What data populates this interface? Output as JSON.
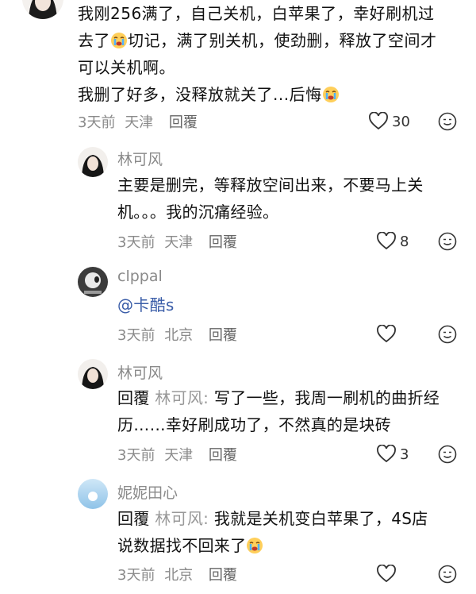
{
  "top_comment": {
    "lines": [
      "我刚256满了，自己关机，白苹果了，幸好刷机过",
      "去了",
      "切记，满了别关机，使劲删，释放了空间才",
      "可以关机啊。",
      "我删了好多，没释放就关了...后悔"
    ],
    "meta_time": "3天前",
    "meta_location": "天津",
    "reply_label": "回覆",
    "likes": "30"
  },
  "replies": [
    {
      "name": "林可风",
      "lines": [
        "主要是删完，等释放空间出来，不要马上关",
        "机。。。我的沉痛经验。"
      ],
      "meta_time": "3天前",
      "meta_location": "天津",
      "reply_label": "回覆",
      "likes": "8"
    },
    {
      "name": "clppal",
      "mention": "@卡酷s",
      "meta_time": "3天前",
      "meta_location": "北京",
      "reply_label": "回覆",
      "likes": ""
    },
    {
      "name": "林可风",
      "reply_prefix": "回覆",
      "quote_name": "林可风:",
      "lines": [
        "写了一些，我周一刷机的曲折经",
        "历……幸好刷成功了，不然真的是块砖"
      ],
      "meta_time": "3天前",
      "meta_location": "天津",
      "reply_label": "回覆",
      "likes": "3"
    },
    {
      "name": "妮妮田心",
      "reply_prefix": "回覆",
      "quote_name": "林可风:",
      "lines": [
        "我就是关机变白苹果了，4S店",
        "说数据找不回来了"
      ],
      "meta_time": "3天前",
      "meta_location": "北京",
      "reply_label": "回覆",
      "likes": ""
    }
  ],
  "icons": {
    "heart": "heart-icon",
    "sticker": "emoji-sticker-icon",
    "crying_emoji": "crying-emoji-icon"
  },
  "colors": {
    "meta": "#8a8a8a",
    "name": "#8a8a8a",
    "mention": "#3a5da8"
  }
}
